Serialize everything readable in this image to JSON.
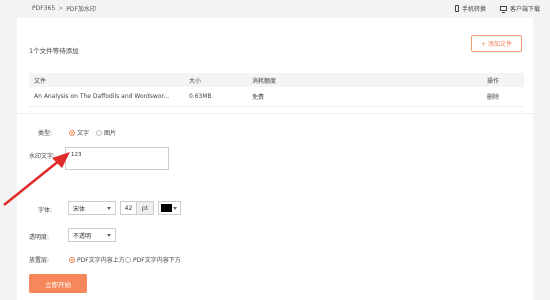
{
  "breadcrumb": {
    "root": "PDF365",
    "sep": ">",
    "current": "PDF加水印"
  },
  "topbar": {
    "mobile_label": "手机转换",
    "client_label": "客户端下载"
  },
  "upload": {
    "waiting_text": "1个文件等待添加",
    "add_button": "+ 添加文件"
  },
  "table": {
    "headers": [
      "文件",
      "大小",
      "消耗额度",
      "操作"
    ],
    "rows": [
      {
        "name": "An Analysis on The Daffodils and Wordswor...",
        "size": "0.63MB",
        "cost": "免费",
        "action": "删除"
      }
    ]
  },
  "form": {
    "type_label": "类型:",
    "type_options": [
      "文字",
      "图片"
    ],
    "type_selected": "文字",
    "watermark_label": "水印文字:",
    "watermark_value": "123",
    "font_label": "字体:",
    "font_value": "宋体",
    "size_value": "42",
    "size_unit": "pt",
    "color_value": "#000000",
    "opacity_label": "透明度:",
    "opacity_value": "不透明",
    "position_label": "放置层:",
    "position_options": [
      "PDF文字内容上方",
      "PDF文字内容下方"
    ],
    "position_selected": "PDF文字内容上方"
  },
  "start_button": "立即开始",
  "colors": {
    "accent": "#f08152",
    "button": "#f5875a",
    "arrow": "#e02b2b"
  }
}
